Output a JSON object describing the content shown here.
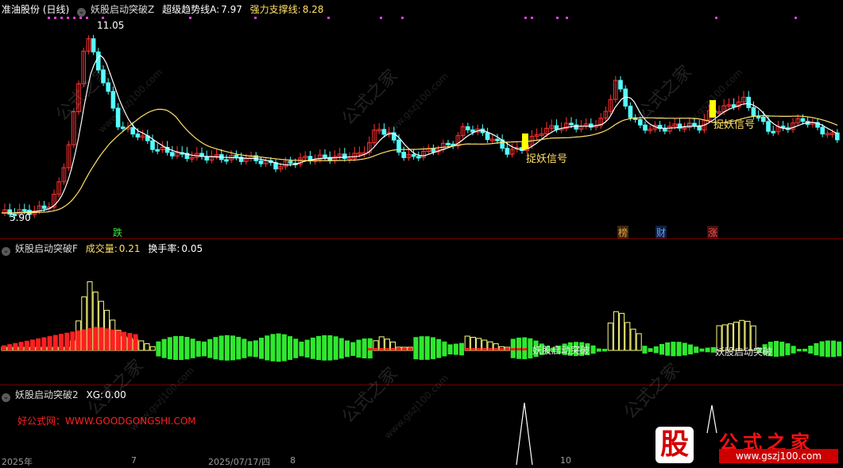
{
  "panel1": {
    "stock_name": "准油股份 (日线)",
    "indicator_name": "妖股启动突破Z",
    "line_a_label": "超级趋势线A:",
    "line_a_value": "7.97",
    "line_b_label": "强力支撑线:",
    "line_b_value": "8.28",
    "high_label": "11.05",
    "low_label": "5.90",
    "signal_label": "捉妖信号",
    "events": [
      "跌",
      "榜",
      "财",
      "涨"
    ]
  },
  "panel2": {
    "indicator_name": "妖股启动突破F",
    "vol_label": "成交量:",
    "vol_value": "0.21",
    "turnover_label": "换手率:",
    "turnover_value": "0.05",
    "signal_label": "妖股启动突破"
  },
  "panel3": {
    "indicator_name": "妖股启动突破2",
    "xg_label": "XG:",
    "xg_value": "0.00",
    "promo_text": "好公式网：WWW.GOODGONGSHI.COM"
  },
  "axis_dates": [
    "2025年",
    "7",
    "2025/07/17/四",
    "8",
    "10"
  ],
  "watermark": {
    "cn": "公式之家",
    "url": "www.gszj100.com"
  },
  "logo": {
    "glyph": "股",
    "title": "公式之家",
    "url": "www.gszj100.com"
  },
  "colors": {
    "up": "#ff3232",
    "down": "#54ffff",
    "ma_white": "#ffffff",
    "ma_yellow": "#ffe066",
    "signal": "#ffff00",
    "osc_green": "#2ee82e",
    "osc_red": "#ff2020",
    "osc_yellow": "#ffff80"
  }
}
